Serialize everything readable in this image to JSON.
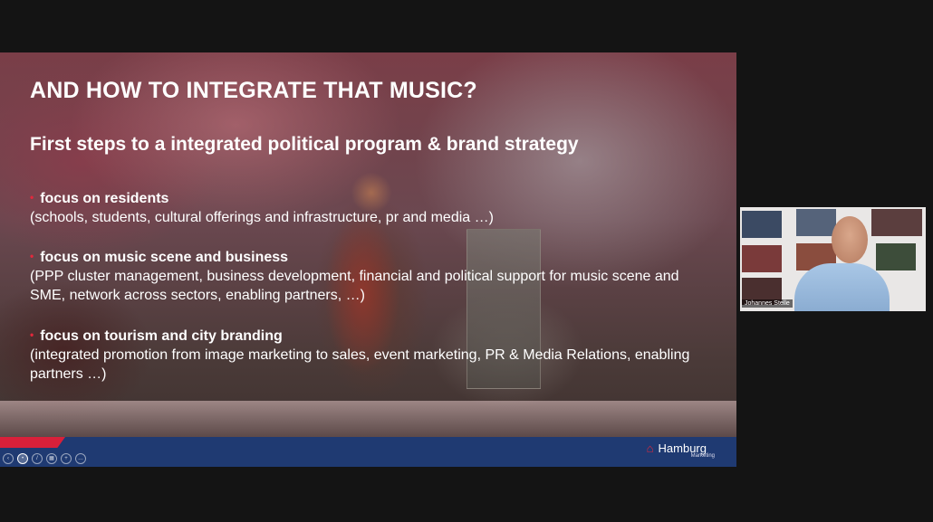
{
  "slide": {
    "title": "AND HOW TO INTEGRATE THAT MUSIC?",
    "subtitle": "First steps to a integrated political program &  brand strategy",
    "bullets": [
      {
        "heading": "focus on residents",
        "text": "(schools, students, cultural offerings and infrastructure, pr and media …)"
      },
      {
        "heading": "focus on music scene and business",
        "text": "(PPP cluster management, business development, financial and political support for music scene and SME, network across sectors, enabling partners, …)"
      },
      {
        "heading": "focus on tourism and city branding",
        "text": "(integrated promotion from image marketing to sales, event marketing, PR & Media Relations, enabling partners …)"
      }
    ],
    "logo": {
      "name": "Hamburg",
      "sub": "Marketing"
    }
  },
  "controls": [
    "prev-icon",
    "pointer-icon",
    "pen-icon",
    "grid-icon",
    "zoom-icon",
    "more-icon"
  ],
  "webcam": {
    "name": "Johannes Stelle"
  },
  "colors": {
    "accent_red": "#d8203a",
    "footer_blue": "#1f3a72"
  }
}
